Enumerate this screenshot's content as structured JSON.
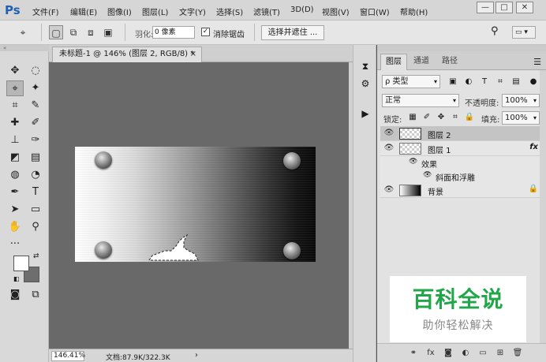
{
  "app": {
    "logo": "Ps"
  },
  "menubar": {
    "items": [
      "文件(F)",
      "编辑(E)",
      "图像(I)",
      "图层(L)",
      "文字(Y)",
      "选择(S)",
      "滤镜(T)",
      "3D(D)",
      "视图(V)",
      "窗口(W)",
      "帮助(H)"
    ],
    "window_controls": {
      "minimize": "—",
      "restore": "□",
      "close": "✕"
    }
  },
  "options": {
    "feather_label": "羽化:",
    "feather_value": "0 像素",
    "antialias_checked": true,
    "antialias_label": "消除锯齿",
    "select_mask_label": "选择并遮住 ..."
  },
  "document": {
    "tab_title": "未标题-1 @ 146% (图层 2, RGB/8) *",
    "tab_close": "×",
    "zoom": "146.41%",
    "doc_info": "文档:87.9K/322.3K",
    "status_arrow": "›"
  },
  "layers_panel": {
    "tabs": [
      "图层",
      "通道",
      "路径"
    ],
    "active_tab": 0,
    "filter_type": "ρ 类型",
    "blend_mode": "正常",
    "opacity_label": "不透明度:",
    "opacity_value": "100%",
    "lock_label": "锁定:",
    "fill_label": "填充:",
    "fill_value": "100%",
    "layers": [
      {
        "name": "图层 2",
        "selected": true,
        "thumb": "transparent"
      },
      {
        "name": "图层 1",
        "selected": false,
        "thumb": "transparent",
        "fx": "fx"
      },
      {
        "name": "背景",
        "selected": false,
        "thumb": "gradient",
        "locked": true
      }
    ],
    "effects_label": "效果",
    "effect_item": "斜面和浮雕"
  },
  "watermark": {
    "title": "百科全说",
    "subtitle": "助你轻松解决"
  },
  "colors": {
    "foreground": "#ffffff",
    "background": "#6e6e6e",
    "brand": "#1f62b1",
    "watermark_green": "#22a64a"
  }
}
